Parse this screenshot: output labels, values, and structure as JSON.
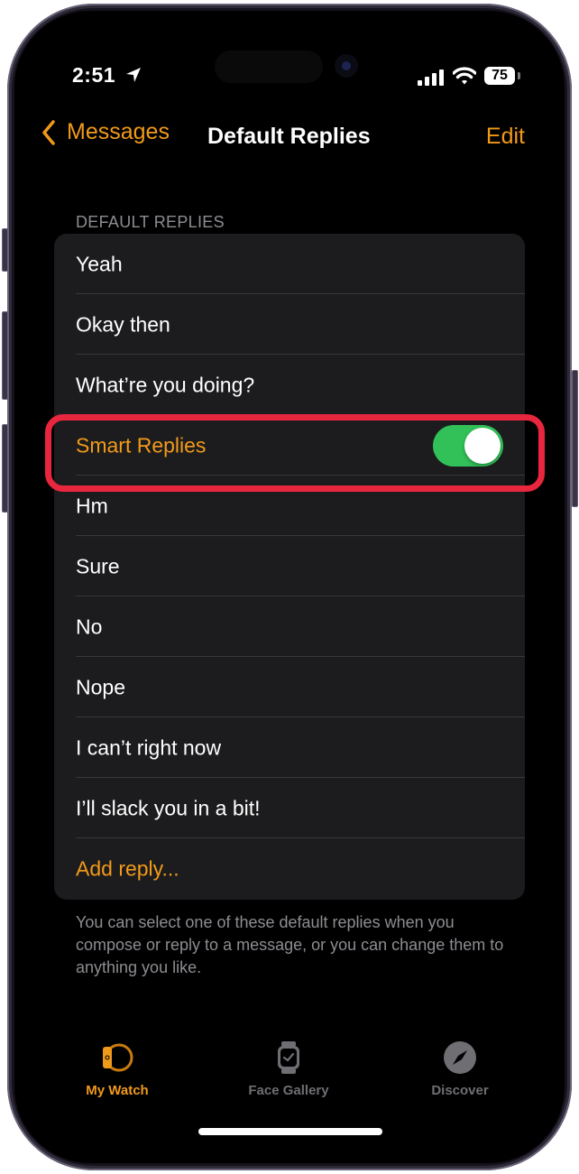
{
  "status_bar": {
    "time": "2:51",
    "battery": "75",
    "location_icon": "location-arrow-icon",
    "signal_icon": "cellular-signal-icon",
    "wifi_icon": "wifi-icon"
  },
  "nav": {
    "back_label": "Messages",
    "title": "Default Replies",
    "edit_label": "Edit"
  },
  "section_header": "DEFAULT REPLIES",
  "replies": [
    {
      "label": "Yeah"
    },
    {
      "label": "Okay then"
    },
    {
      "label": "What’re you doing?"
    },
    {
      "label": "Smart Replies",
      "toggle": true,
      "toggle_on": true
    },
    {
      "label": "Hm"
    },
    {
      "label": "Sure"
    },
    {
      "label": "No"
    },
    {
      "label": "Nope"
    },
    {
      "label": "I can’t right now"
    },
    {
      "label": "I’ll slack you in a bit!"
    },
    {
      "label": "Add reply..."
    }
  ],
  "footer_text": "You can select one of these default replies when you compose or reply to a message, or you can change them to anything you like.",
  "tabs": [
    {
      "label": "My Watch",
      "icon": "my-watch-icon",
      "active": true
    },
    {
      "label": "Face Gallery",
      "icon": "watch-face-icon",
      "active": false
    },
    {
      "label": "Discover",
      "icon": "compass-icon",
      "active": false
    }
  ],
  "colors": {
    "accent": "#f19a1a",
    "toggle_on": "#31c158",
    "highlight": "#e8263d",
    "list_bg": "#1c1c1e",
    "secondary_text": "#8d8d92"
  }
}
